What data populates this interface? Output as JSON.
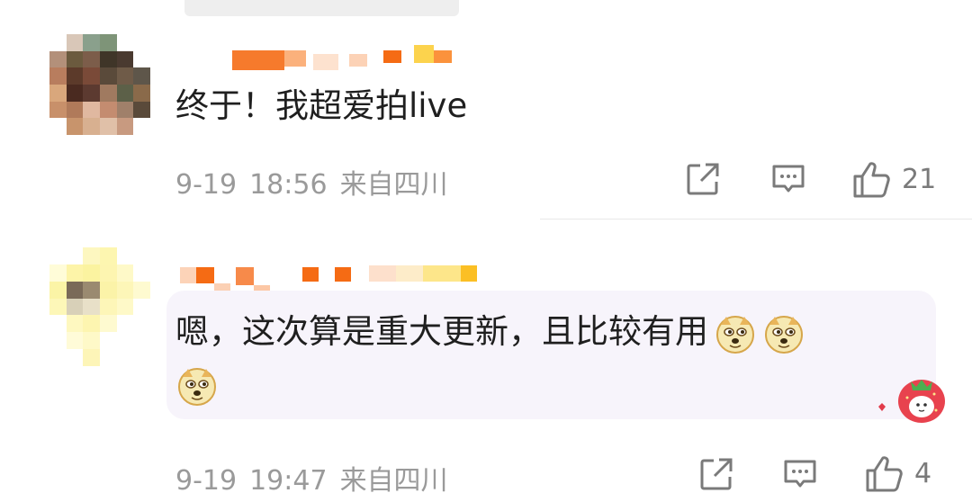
{
  "comments": [
    {
      "text": "终于！我超爱拍live",
      "meta": {
        "date": "9-19",
        "time": "18:56",
        "location": "来自四川"
      },
      "actions": {
        "share_icon": "share-external-icon",
        "reply_icon": "comment-icon",
        "like_icon": "thumbs-up-icon",
        "like_count": "21"
      }
    },
    {
      "text": "嗯，这次算是重大更新，且比较有用",
      "emojis": [
        "doge-emoji",
        "doge-emoji",
        "doge-emoji"
      ],
      "meta": {
        "date": "9-19",
        "time": "19:47",
        "location": "来自四川"
      },
      "actions": {
        "share_icon": "share-external-icon",
        "reply_icon": "comment-icon",
        "like_icon": "thumbs-up-icon",
        "like_count": "4"
      }
    }
  ],
  "colors": {
    "username_orange": "#f26d12",
    "meta_gray": "#9a9a9a",
    "highlight_bg": "#f7f4fb",
    "icon_gray": "#7a7a7a"
  }
}
